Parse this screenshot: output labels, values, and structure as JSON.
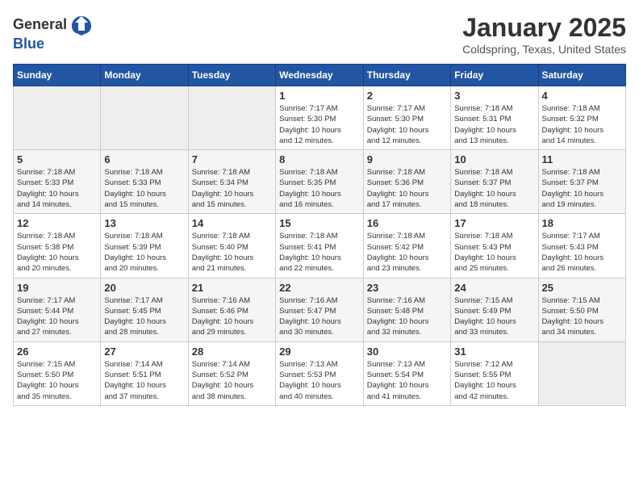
{
  "logo": {
    "general": "General",
    "blue": "Blue"
  },
  "header": {
    "title": "January 2025",
    "subtitle": "Coldspring, Texas, United States"
  },
  "weekdays": [
    "Sunday",
    "Monday",
    "Tuesday",
    "Wednesday",
    "Thursday",
    "Friday",
    "Saturday"
  ],
  "weeks": [
    [
      {
        "day": "",
        "info": ""
      },
      {
        "day": "",
        "info": ""
      },
      {
        "day": "",
        "info": ""
      },
      {
        "day": "1",
        "info": "Sunrise: 7:17 AM\nSunset: 5:30 PM\nDaylight: 10 hours\nand 12 minutes."
      },
      {
        "day": "2",
        "info": "Sunrise: 7:17 AM\nSunset: 5:30 PM\nDaylight: 10 hours\nand 12 minutes."
      },
      {
        "day": "3",
        "info": "Sunrise: 7:18 AM\nSunset: 5:31 PM\nDaylight: 10 hours\nand 13 minutes."
      },
      {
        "day": "4",
        "info": "Sunrise: 7:18 AM\nSunset: 5:32 PM\nDaylight: 10 hours\nand 14 minutes."
      }
    ],
    [
      {
        "day": "5",
        "info": "Sunrise: 7:18 AM\nSunset: 5:33 PM\nDaylight: 10 hours\nand 14 minutes."
      },
      {
        "day": "6",
        "info": "Sunrise: 7:18 AM\nSunset: 5:33 PM\nDaylight: 10 hours\nand 15 minutes."
      },
      {
        "day": "7",
        "info": "Sunrise: 7:18 AM\nSunset: 5:34 PM\nDaylight: 10 hours\nand 15 minutes."
      },
      {
        "day": "8",
        "info": "Sunrise: 7:18 AM\nSunset: 5:35 PM\nDaylight: 10 hours\nand 16 minutes."
      },
      {
        "day": "9",
        "info": "Sunrise: 7:18 AM\nSunset: 5:36 PM\nDaylight: 10 hours\nand 17 minutes."
      },
      {
        "day": "10",
        "info": "Sunrise: 7:18 AM\nSunset: 5:37 PM\nDaylight: 10 hours\nand 18 minutes."
      },
      {
        "day": "11",
        "info": "Sunrise: 7:18 AM\nSunset: 5:37 PM\nDaylight: 10 hours\nand 19 minutes."
      }
    ],
    [
      {
        "day": "12",
        "info": "Sunrise: 7:18 AM\nSunset: 5:38 PM\nDaylight: 10 hours\nand 20 minutes."
      },
      {
        "day": "13",
        "info": "Sunrise: 7:18 AM\nSunset: 5:39 PM\nDaylight: 10 hours\nand 20 minutes."
      },
      {
        "day": "14",
        "info": "Sunrise: 7:18 AM\nSunset: 5:40 PM\nDaylight: 10 hours\nand 21 minutes."
      },
      {
        "day": "15",
        "info": "Sunrise: 7:18 AM\nSunset: 5:41 PM\nDaylight: 10 hours\nand 22 minutes."
      },
      {
        "day": "16",
        "info": "Sunrise: 7:18 AM\nSunset: 5:42 PM\nDaylight: 10 hours\nand 23 minutes."
      },
      {
        "day": "17",
        "info": "Sunrise: 7:18 AM\nSunset: 5:43 PM\nDaylight: 10 hours\nand 25 minutes."
      },
      {
        "day": "18",
        "info": "Sunrise: 7:17 AM\nSunset: 5:43 PM\nDaylight: 10 hours\nand 26 minutes."
      }
    ],
    [
      {
        "day": "19",
        "info": "Sunrise: 7:17 AM\nSunset: 5:44 PM\nDaylight: 10 hours\nand 27 minutes."
      },
      {
        "day": "20",
        "info": "Sunrise: 7:17 AM\nSunset: 5:45 PM\nDaylight: 10 hours\nand 28 minutes."
      },
      {
        "day": "21",
        "info": "Sunrise: 7:16 AM\nSunset: 5:46 PM\nDaylight: 10 hours\nand 29 minutes."
      },
      {
        "day": "22",
        "info": "Sunrise: 7:16 AM\nSunset: 5:47 PM\nDaylight: 10 hours\nand 30 minutes."
      },
      {
        "day": "23",
        "info": "Sunrise: 7:16 AM\nSunset: 5:48 PM\nDaylight: 10 hours\nand 32 minutes."
      },
      {
        "day": "24",
        "info": "Sunrise: 7:15 AM\nSunset: 5:49 PM\nDaylight: 10 hours\nand 33 minutes."
      },
      {
        "day": "25",
        "info": "Sunrise: 7:15 AM\nSunset: 5:50 PM\nDaylight: 10 hours\nand 34 minutes."
      }
    ],
    [
      {
        "day": "26",
        "info": "Sunrise: 7:15 AM\nSunset: 5:50 PM\nDaylight: 10 hours\nand 35 minutes."
      },
      {
        "day": "27",
        "info": "Sunrise: 7:14 AM\nSunset: 5:51 PM\nDaylight: 10 hours\nand 37 minutes."
      },
      {
        "day": "28",
        "info": "Sunrise: 7:14 AM\nSunset: 5:52 PM\nDaylight: 10 hours\nand 38 minutes."
      },
      {
        "day": "29",
        "info": "Sunrise: 7:13 AM\nSunset: 5:53 PM\nDaylight: 10 hours\nand 40 minutes."
      },
      {
        "day": "30",
        "info": "Sunrise: 7:13 AM\nSunset: 5:54 PM\nDaylight: 10 hours\nand 41 minutes."
      },
      {
        "day": "31",
        "info": "Sunrise: 7:12 AM\nSunset: 5:55 PM\nDaylight: 10 hours\nand 42 minutes."
      },
      {
        "day": "",
        "info": ""
      }
    ]
  ]
}
